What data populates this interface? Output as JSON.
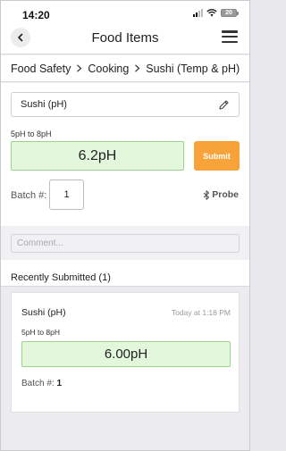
{
  "status_bar": {
    "time": "14:20",
    "battery": "20"
  },
  "nav": {
    "title": "Food Items"
  },
  "breadcrumb": {
    "items": [
      "Food Safety",
      "Cooking",
      "Sushi (Temp & pH)"
    ]
  },
  "form": {
    "item_name": "Sushi (pH)",
    "range": "5pH to 8pH",
    "value": "6.2pH",
    "submit_label": "Submit",
    "batch_label": "Batch #:",
    "batch_value": "1",
    "probe_label": "Probe",
    "comment_placeholder": "Comment..."
  },
  "recent": {
    "title": "Recently Submitted (1)",
    "entries": [
      {
        "name": "Sushi (pH)",
        "time": "Today at 1:18 PM",
        "range": "5pH to 8pH",
        "value": "6.00pH",
        "batch_label": "Batch #:",
        "batch_value": "1"
      }
    ]
  },
  "colors": {
    "accent_orange": "#f8a33a",
    "in_range_green_bg": "#e3f7dd",
    "in_range_green_border": "#9bd58b"
  },
  "icons": [
    "back-chevron-icon",
    "hamburger-menu-icon",
    "chevron-right-icon",
    "pencil-icon",
    "bluetooth-icon",
    "signal-icon",
    "wifi-icon",
    "battery-icon"
  ]
}
